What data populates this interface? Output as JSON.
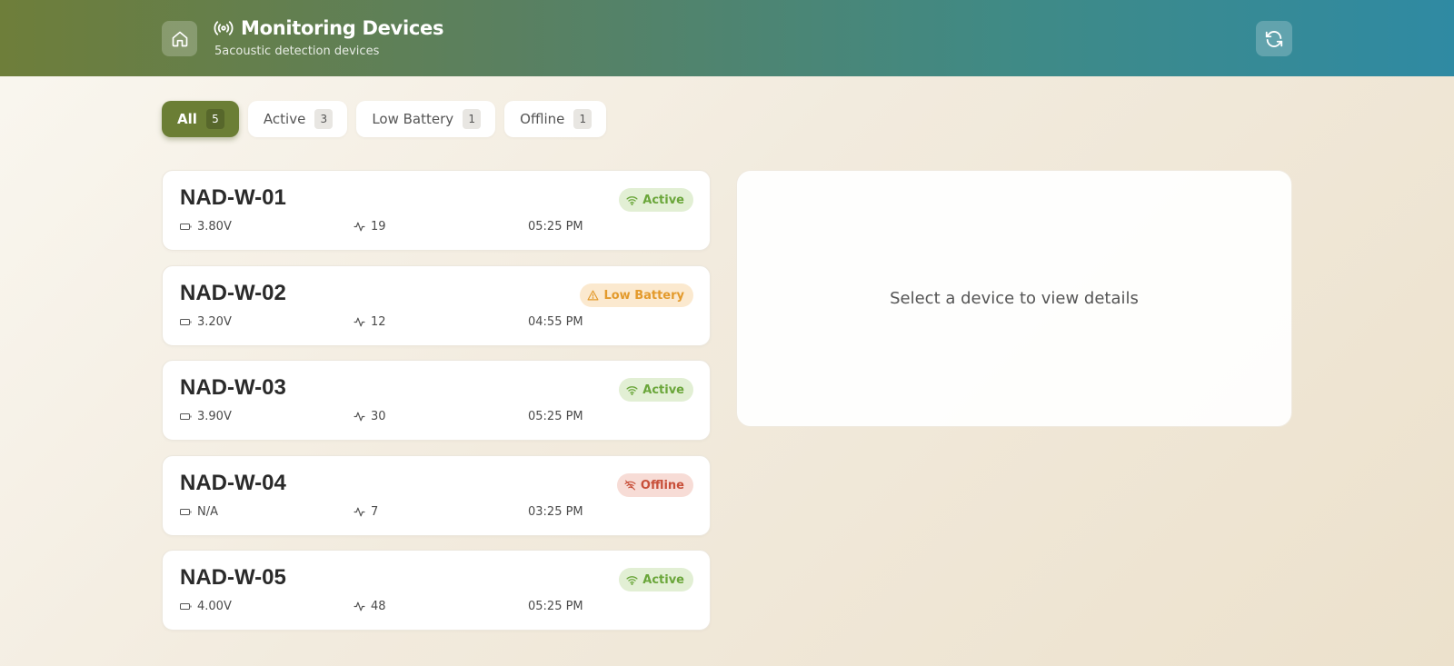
{
  "header": {
    "title": "Monitoring Devices",
    "subtitle": "5acoustic detection devices",
    "home_icon": "home-icon",
    "refresh_icon": "refresh-icon",
    "title_icon": "radio-signal-icon"
  },
  "filters": [
    {
      "label": "All",
      "count": "5",
      "selected": true
    },
    {
      "label": "Active",
      "count": "3",
      "selected": false
    },
    {
      "label": "Low Battery",
      "count": "1",
      "selected": false
    },
    {
      "label": "Offline",
      "count": "1",
      "selected": false
    }
  ],
  "devices": [
    {
      "name": "NAD-W-01",
      "status": "Active",
      "status_type": "active",
      "voltage": "3.80V",
      "events": "19",
      "time": "05:25 PM"
    },
    {
      "name": "NAD-W-02",
      "status": "Low Battery",
      "status_type": "low",
      "voltage": "3.20V",
      "events": "12",
      "time": "04:55 PM"
    },
    {
      "name": "NAD-W-03",
      "status": "Active",
      "status_type": "active",
      "voltage": "3.90V",
      "events": "30",
      "time": "05:25 PM"
    },
    {
      "name": "NAD-W-04",
      "status": "Offline",
      "status_type": "offline",
      "voltage": "N/A",
      "events": "7",
      "time": "03:25 PM"
    },
    {
      "name": "NAD-W-05",
      "status": "Active",
      "status_type": "active",
      "voltage": "4.00V",
      "events": "48",
      "time": "05:25 PM"
    }
  ],
  "detail": {
    "empty_message": "Select a device to view details"
  },
  "colors": {
    "accent": "#6b7e35",
    "active": "#6aa63a",
    "low_battery": "#e39a2c",
    "offline": "#c8503a"
  }
}
